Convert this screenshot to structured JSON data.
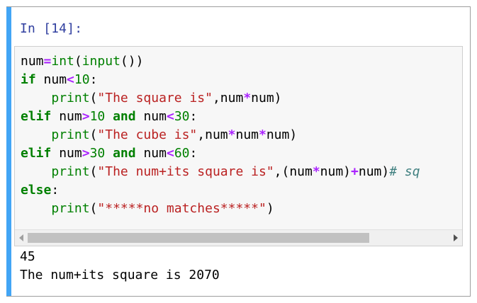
{
  "cell": {
    "prompt": "In [14]:",
    "code_lines": [
      [
        {
          "t": "num",
          "c": "plain"
        },
        {
          "t": "=",
          "c": "op"
        },
        {
          "t": "int",
          "c": "bi"
        },
        {
          "t": "(",
          "c": "plain"
        },
        {
          "t": "input",
          "c": "bi"
        },
        {
          "t": "())",
          "c": "plain"
        }
      ],
      [
        {
          "t": "if",
          "c": "kw"
        },
        {
          "t": " num",
          "c": "plain"
        },
        {
          "t": "<",
          "c": "op"
        },
        {
          "t": "10",
          "c": "num"
        },
        {
          "t": ":",
          "c": "plain"
        }
      ],
      [
        {
          "t": "    ",
          "c": "plain"
        },
        {
          "t": "print",
          "c": "bi"
        },
        {
          "t": "(",
          "c": "plain"
        },
        {
          "t": "\"The square is\"",
          "c": "str"
        },
        {
          "t": ",num",
          "c": "plain"
        },
        {
          "t": "*",
          "c": "op"
        },
        {
          "t": "num)",
          "c": "plain"
        }
      ],
      [
        {
          "t": "elif",
          "c": "kw"
        },
        {
          "t": " num",
          "c": "plain"
        },
        {
          "t": ">",
          "c": "op"
        },
        {
          "t": "10",
          "c": "num"
        },
        {
          "t": " ",
          "c": "plain"
        },
        {
          "t": "and",
          "c": "kw"
        },
        {
          "t": " num",
          "c": "plain"
        },
        {
          "t": "<",
          "c": "op"
        },
        {
          "t": "30",
          "c": "num"
        },
        {
          "t": ":",
          "c": "plain"
        }
      ],
      [
        {
          "t": "    ",
          "c": "plain"
        },
        {
          "t": "print",
          "c": "bi"
        },
        {
          "t": "(",
          "c": "plain"
        },
        {
          "t": "\"The cube is\"",
          "c": "str"
        },
        {
          "t": ",num",
          "c": "plain"
        },
        {
          "t": "*",
          "c": "op"
        },
        {
          "t": "num",
          "c": "plain"
        },
        {
          "t": "*",
          "c": "op"
        },
        {
          "t": "num)",
          "c": "plain"
        }
      ],
      [
        {
          "t": "elif",
          "c": "kw"
        },
        {
          "t": " num",
          "c": "plain"
        },
        {
          "t": ">",
          "c": "op"
        },
        {
          "t": "30",
          "c": "num"
        },
        {
          "t": " ",
          "c": "plain"
        },
        {
          "t": "and",
          "c": "kw"
        },
        {
          "t": " num",
          "c": "plain"
        },
        {
          "t": "<",
          "c": "op"
        },
        {
          "t": "60",
          "c": "num"
        },
        {
          "t": ":",
          "c": "plain"
        }
      ],
      [
        {
          "t": "    ",
          "c": "plain"
        },
        {
          "t": "print",
          "c": "bi"
        },
        {
          "t": "(",
          "c": "plain"
        },
        {
          "t": "\"The num+its square is\"",
          "c": "str"
        },
        {
          "t": ",(num",
          "c": "plain"
        },
        {
          "t": "*",
          "c": "op"
        },
        {
          "t": "num)",
          "c": "plain"
        },
        {
          "t": "+",
          "c": "op"
        },
        {
          "t": "num)",
          "c": "plain"
        },
        {
          "t": "# sq",
          "c": "com"
        }
      ],
      [
        {
          "t": "else",
          "c": "kw"
        },
        {
          "t": ":",
          "c": "plain"
        }
      ],
      [
        {
          "t": "    ",
          "c": "plain"
        },
        {
          "t": "print",
          "c": "bi"
        },
        {
          "t": "(",
          "c": "plain"
        },
        {
          "t": "\"*****no matches*****\"",
          "c": "str"
        },
        {
          "t": ")",
          "c": "plain"
        }
      ]
    ],
    "output_lines": [
      "45",
      "The num+its square is 2070"
    ]
  }
}
